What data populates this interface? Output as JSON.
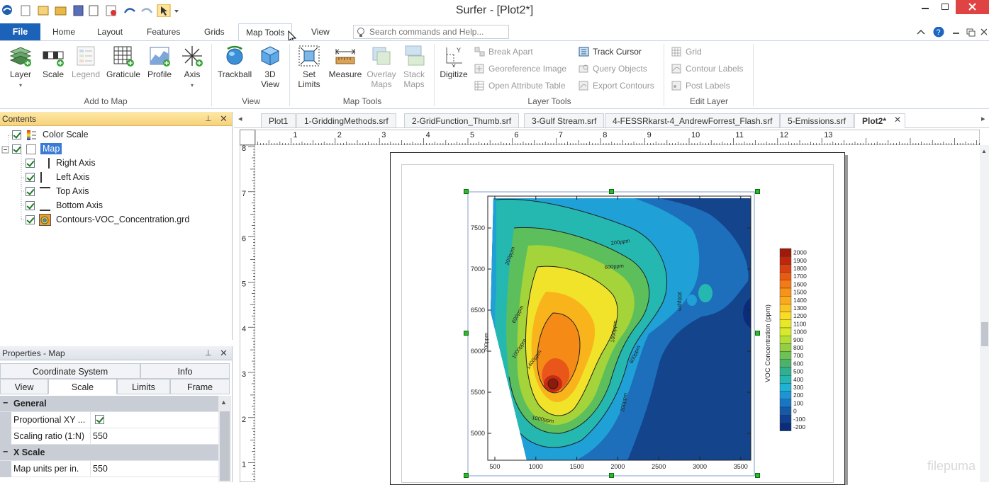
{
  "window": {
    "title": "Surfer - [Plot2*]"
  },
  "menu": {
    "file": "File",
    "tabs": [
      "Home",
      "Layout",
      "Features",
      "Grids",
      "Map Tools",
      "View"
    ],
    "search_placeholder": "Search commands and Help..."
  },
  "ribbon": {
    "add_to_map": {
      "label": "Add to Map",
      "layer": "Layer",
      "scale": "Scale",
      "legend": "Legend",
      "graticule": "Graticule",
      "profile": "Profile",
      "axis": "Axis"
    },
    "view": {
      "label": "View",
      "trackball": "Trackball",
      "view3d_line1": "3D",
      "view3d_line2": "View"
    },
    "map_tools": {
      "label": "Map Tools",
      "set_limits_line1": "Set",
      "set_limits_line2": "Limits",
      "measure": "Measure",
      "overlay_line1": "Overlay",
      "overlay_line2": "Maps",
      "stack_line1": "Stack",
      "stack_line2": "Maps"
    },
    "layer_tools": {
      "label": "Layer Tools",
      "digitize": "Digitize",
      "break_apart": "Break Apart",
      "georeference": "Georeference Image",
      "open_attr": "Open Attribute Table",
      "track_cursor": "Track Cursor",
      "query_objects": "Query Objects",
      "export_contours": "Export Contours"
    },
    "edit_layer": {
      "label": "Edit Layer",
      "grid": "Grid",
      "contour_labels": "Contour Labels",
      "post_labels": "Post Labels"
    }
  },
  "contents": {
    "title": "Contents",
    "items": [
      "Color Scale",
      "Map",
      "Right Axis",
      "Left Axis",
      "Top Axis",
      "Bottom Axis",
      "Contours-VOC_Concentration.grd"
    ]
  },
  "properties": {
    "title": "Properties - Map",
    "tabs_row1": [
      "Coordinate System",
      "Info"
    ],
    "tabs_row2": [
      "View",
      "Scale",
      "Limits",
      "Frame"
    ],
    "general": "General",
    "proportional_label": "Proportional XY ...",
    "scaling_label": "Scaling ratio (1:N)",
    "scaling_value": "550",
    "xscale": "X Scale",
    "map_units_label": "Map units per in.",
    "map_units_value": "550"
  },
  "doc_tabs": [
    "Plot1",
    "1-GriddingMethods.srf",
    "2-GridFunction_Thumb.srf",
    "3-Gulf Stream.srf",
    "4-FESSRkarst-4_AndrewForrest_Flash.srf",
    "5-Emissions.srf",
    "Plot2*"
  ],
  "ruler": {
    "top": [
      "1",
      "2",
      "3",
      "4",
      "5",
      "6",
      "7",
      "8",
      "9",
      "10",
      "11",
      "12",
      "13"
    ],
    "left": [
      "8",
      "7",
      "6",
      "5",
      "4",
      "3",
      "2",
      "1"
    ]
  },
  "map": {
    "x_ticks": [
      "500",
      "1000",
      "1500",
      "2000",
      "2500",
      "3000",
      "3500"
    ],
    "y_ticks": [
      "7500",
      "7000",
      "6500",
      "6000",
      "5500",
      "5000"
    ],
    "contour_labels": [
      "200ppm",
      "600ppm",
      "200ppm",
      "600ppm",
      "1000ppm",
      "1400ppm",
      "1000ppm",
      "600ppm",
      "1000ppm",
      "200ppm",
      "200ppm",
      "200ppm"
    ],
    "colorbar_title": "VOC Concentration (ppm)",
    "colorbar_values": [
      "2000",
      "1900",
      "1800",
      "1700",
      "1600",
      "1500",
      "1400",
      "1300",
      "1200",
      "1100",
      "1000",
      "900",
      "800",
      "700",
      "600",
      "500",
      "400",
      "300",
      "200",
      "100",
      "0",
      "-100",
      "-200"
    ],
    "colorbar_colors": [
      "#9e1a0a",
      "#c0260b",
      "#d9400f",
      "#ea5a12",
      "#f47a14",
      "#f99218",
      "#fbaa1c",
      "#fcc420",
      "#f8dd22",
      "#e9e827",
      "#d6ea2a",
      "#b5de34",
      "#92d042",
      "#6cc254",
      "#4ab36c",
      "#2fb08e",
      "#22b7b3",
      "#1fb2d3",
      "#1c95d4",
      "#1976c4",
      "#155aa8",
      "#10408f",
      "#0b2c78"
    ]
  },
  "watermark": "filepuma"
}
